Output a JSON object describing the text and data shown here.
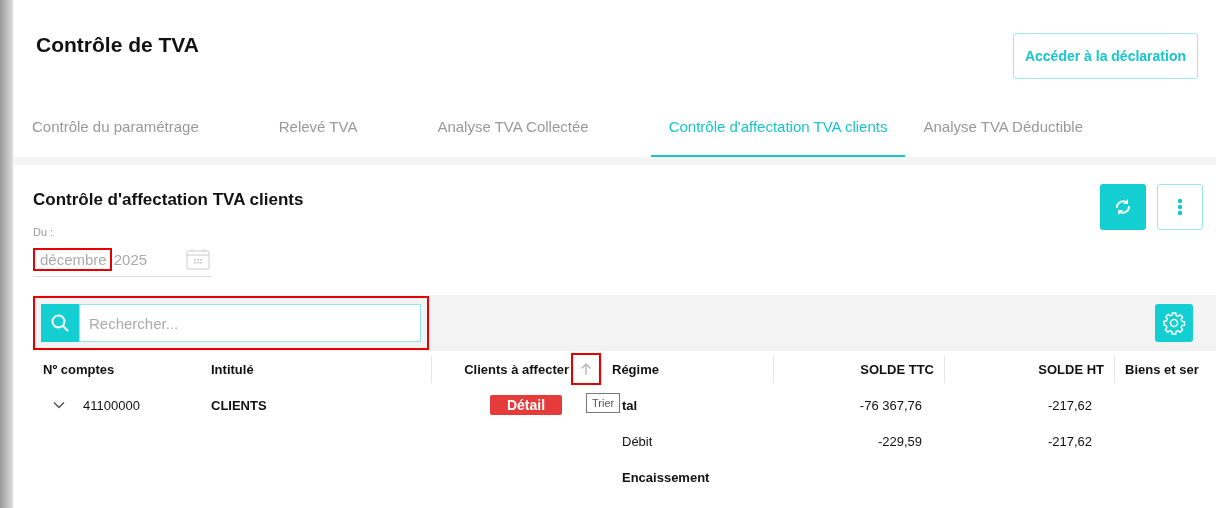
{
  "page": {
    "title": "Contrôle de TVA",
    "action_button": "Accéder à la déclaration"
  },
  "tabs": [
    {
      "label": "Contrôle du paramétrage",
      "selected": false
    },
    {
      "label": "Relevé TVA",
      "selected": false
    },
    {
      "label": "Analyse TVA Collectée",
      "selected": false
    },
    {
      "label": "Contrôle d'affectation TVA clients",
      "selected": true
    },
    {
      "label": "Analyse TVA Déductible",
      "selected": false
    }
  ],
  "section": {
    "title": "Contrôle d'affectation TVA clients",
    "date_filter": {
      "label": "Du :",
      "month": "décembre",
      "month_highlighted": true,
      "year": "2025"
    },
    "search": {
      "placeholder": "Rechercher...",
      "highlighted": true
    }
  },
  "table": {
    "columns": [
      {
        "label": "Nº comptes"
      },
      {
        "label": "Intitulé"
      },
      {
        "label": "Clients à affecter",
        "sort_highlighted": true,
        "tooltip": "Trier"
      },
      {
        "label": "Régime"
      },
      {
        "label": "SOLDE TTC"
      },
      {
        "label": "SOLDE HT"
      },
      {
        "label": "Biens et ser"
      }
    ],
    "rows": [
      {
        "expanded": false,
        "account": "41100000",
        "name": "CLIENTS",
        "badge": "Détail",
        "regime": "tal",
        "regime_bold": true,
        "ttc": "-76 367,76",
        "ht": "-217,62"
      },
      {
        "regime": "Débit",
        "regime_bold": false,
        "ttc": "-229,59",
        "ht": "-217,62"
      },
      {
        "regime": "Encaissement",
        "regime_bold": true
      }
    ]
  }
}
